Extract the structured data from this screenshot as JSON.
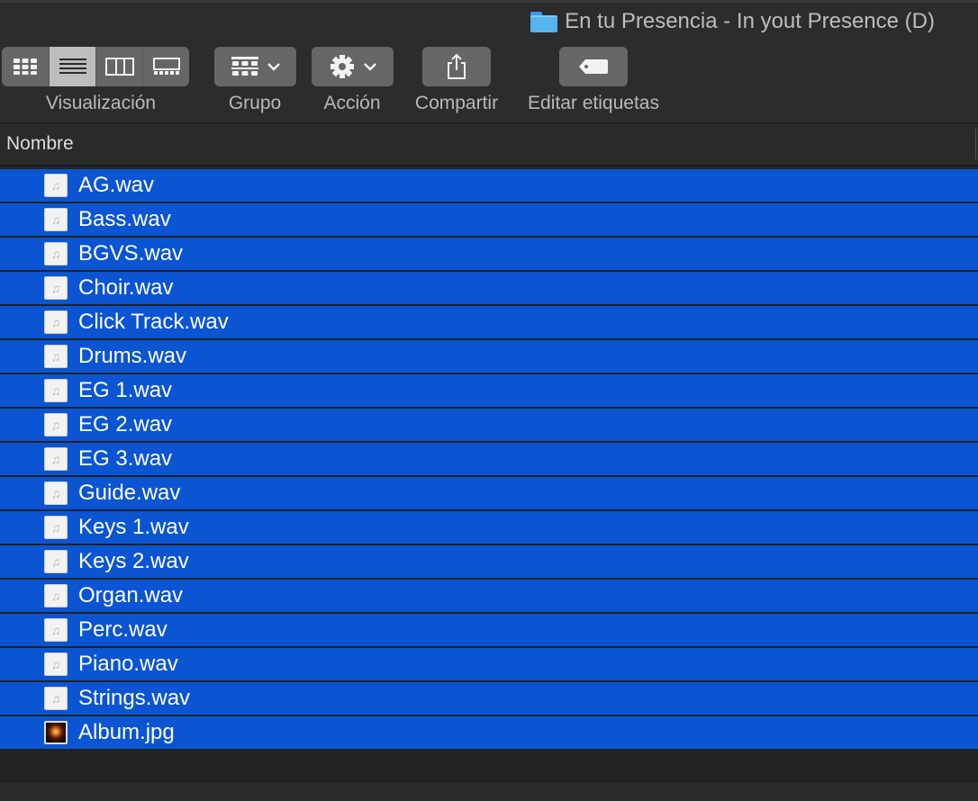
{
  "window": {
    "title": "En tu Presencia - In yout Presence (D)"
  },
  "toolbar": {
    "view_label": "Visualización",
    "group_label": "Grupo",
    "action_label": "Acción",
    "share_label": "Compartir",
    "tags_label": "Editar etiquetas",
    "view_modes": [
      "icon-view",
      "list-view",
      "column-view",
      "gallery-view"
    ],
    "active_view": "list-view"
  },
  "list": {
    "column_header": "Nombre",
    "files": [
      {
        "name": "AG.wav",
        "icon": "audio-file-icon"
      },
      {
        "name": "Bass.wav",
        "icon": "audio-file-icon"
      },
      {
        "name": "BGVS.wav",
        "icon": "audio-file-icon"
      },
      {
        "name": "Choir.wav",
        "icon": "audio-file-icon"
      },
      {
        "name": "Click Track.wav",
        "icon": "audio-file-icon"
      },
      {
        "name": "Drums.wav",
        "icon": "audio-file-icon"
      },
      {
        "name": "EG 1.wav",
        "icon": "audio-file-icon"
      },
      {
        "name": "EG 2.wav",
        "icon": "audio-file-icon"
      },
      {
        "name": "EG 3.wav",
        "icon": "audio-file-icon"
      },
      {
        "name": "Guide.wav",
        "icon": "audio-file-icon"
      },
      {
        "name": "Keys 1.wav",
        "icon": "audio-file-icon"
      },
      {
        "name": "Keys 2.wav",
        "icon": "audio-file-icon"
      },
      {
        "name": "Organ.wav",
        "icon": "audio-file-icon"
      },
      {
        "name": "Perc.wav",
        "icon": "audio-file-icon"
      },
      {
        "name": "Piano.wav",
        "icon": "audio-file-icon"
      },
      {
        "name": "Strings.wav",
        "icon": "audio-file-icon"
      },
      {
        "name": "Album.jpg",
        "icon": "image-file-icon"
      }
    ]
  },
  "colors": {
    "selection": "#0b55d3",
    "folder": "#58b3ee"
  }
}
